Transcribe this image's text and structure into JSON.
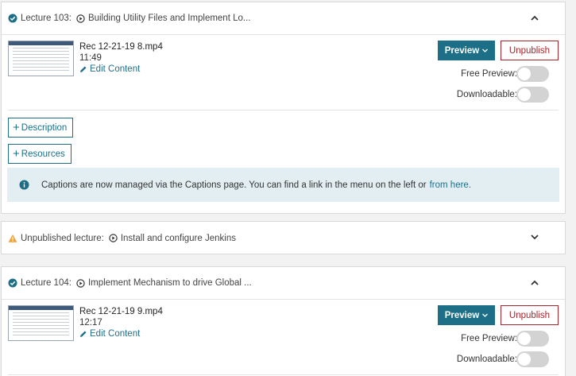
{
  "lectures": [
    {
      "header": "Lecture 103:",
      "title": "Building Utility Files and Implement Lo...",
      "file_name": "Rec 12-21-19 8.mp4",
      "duration": "11:49"
    },
    {
      "header": "Lecture 104:",
      "title": "Implement Mechanism to drive Global ...",
      "file_name": "Rec 12-21-19 9.mp4",
      "duration": "12:17"
    }
  ],
  "unpublished": {
    "header": "Unpublished lecture:",
    "title": "Install and configure Jenkins"
  },
  "labels": {
    "edit_content": "Edit Content",
    "preview": "Preview",
    "unpublish": "Unpublish",
    "free_preview": "Free Preview:",
    "downloadable": "Downloadable:",
    "description": "Description",
    "resources": "Resources"
  },
  "info": {
    "text": "Captions are now managed via the Captions page. You can find a link in the menu on the left or",
    "link": "from here."
  },
  "toggles": {
    "free_preview_on": false,
    "downloadable_on": false
  },
  "colors": {
    "primary": "#1c6f86",
    "unpublish": "#a4262c",
    "success": "#1c6f86",
    "warning": "#f0a030",
    "info_bg": "#e3eef2"
  },
  "icons": {
    "status_ok": "check-circle-icon",
    "status_warning": "warning-triangle-icon",
    "play": "play-circle-icon",
    "expand": "chevron-icon",
    "edit": "pencil-icon",
    "add": "plus-icon",
    "info": "info-circle-icon"
  }
}
